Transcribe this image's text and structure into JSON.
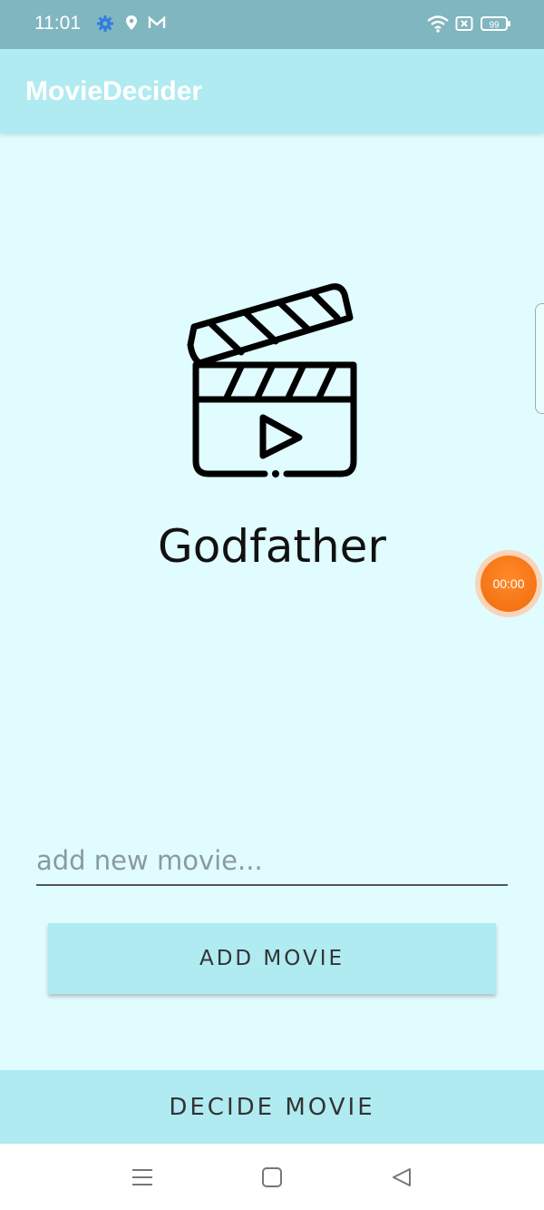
{
  "status_bar": {
    "time": "11:01",
    "battery": "99",
    "icons": [
      "gear-icon",
      "location-pin-icon",
      "mail-icon",
      "wifi-icon",
      "sim-x-icon",
      "battery-icon"
    ]
  },
  "app_bar": {
    "title": "MovieDecider"
  },
  "main": {
    "icon": "clapperboard-icon",
    "selected_movie": "Godfather"
  },
  "recorder": {
    "time": "00:00",
    "color": "#f26a0a"
  },
  "form": {
    "input_value": "",
    "input_placeholder": "add new movie...",
    "add_button_label": "ADD MOVIE"
  },
  "decide_button_label": "DECIDE MOVIE",
  "nav_bar": {
    "icons": [
      "menu-icon",
      "home-square-icon",
      "back-triangle-icon"
    ]
  },
  "colors": {
    "status_bar": "#80b6bf",
    "app_bar": "#b0ebf1",
    "background": "#e0fcfe",
    "accent_button": "#b0ebf1"
  }
}
